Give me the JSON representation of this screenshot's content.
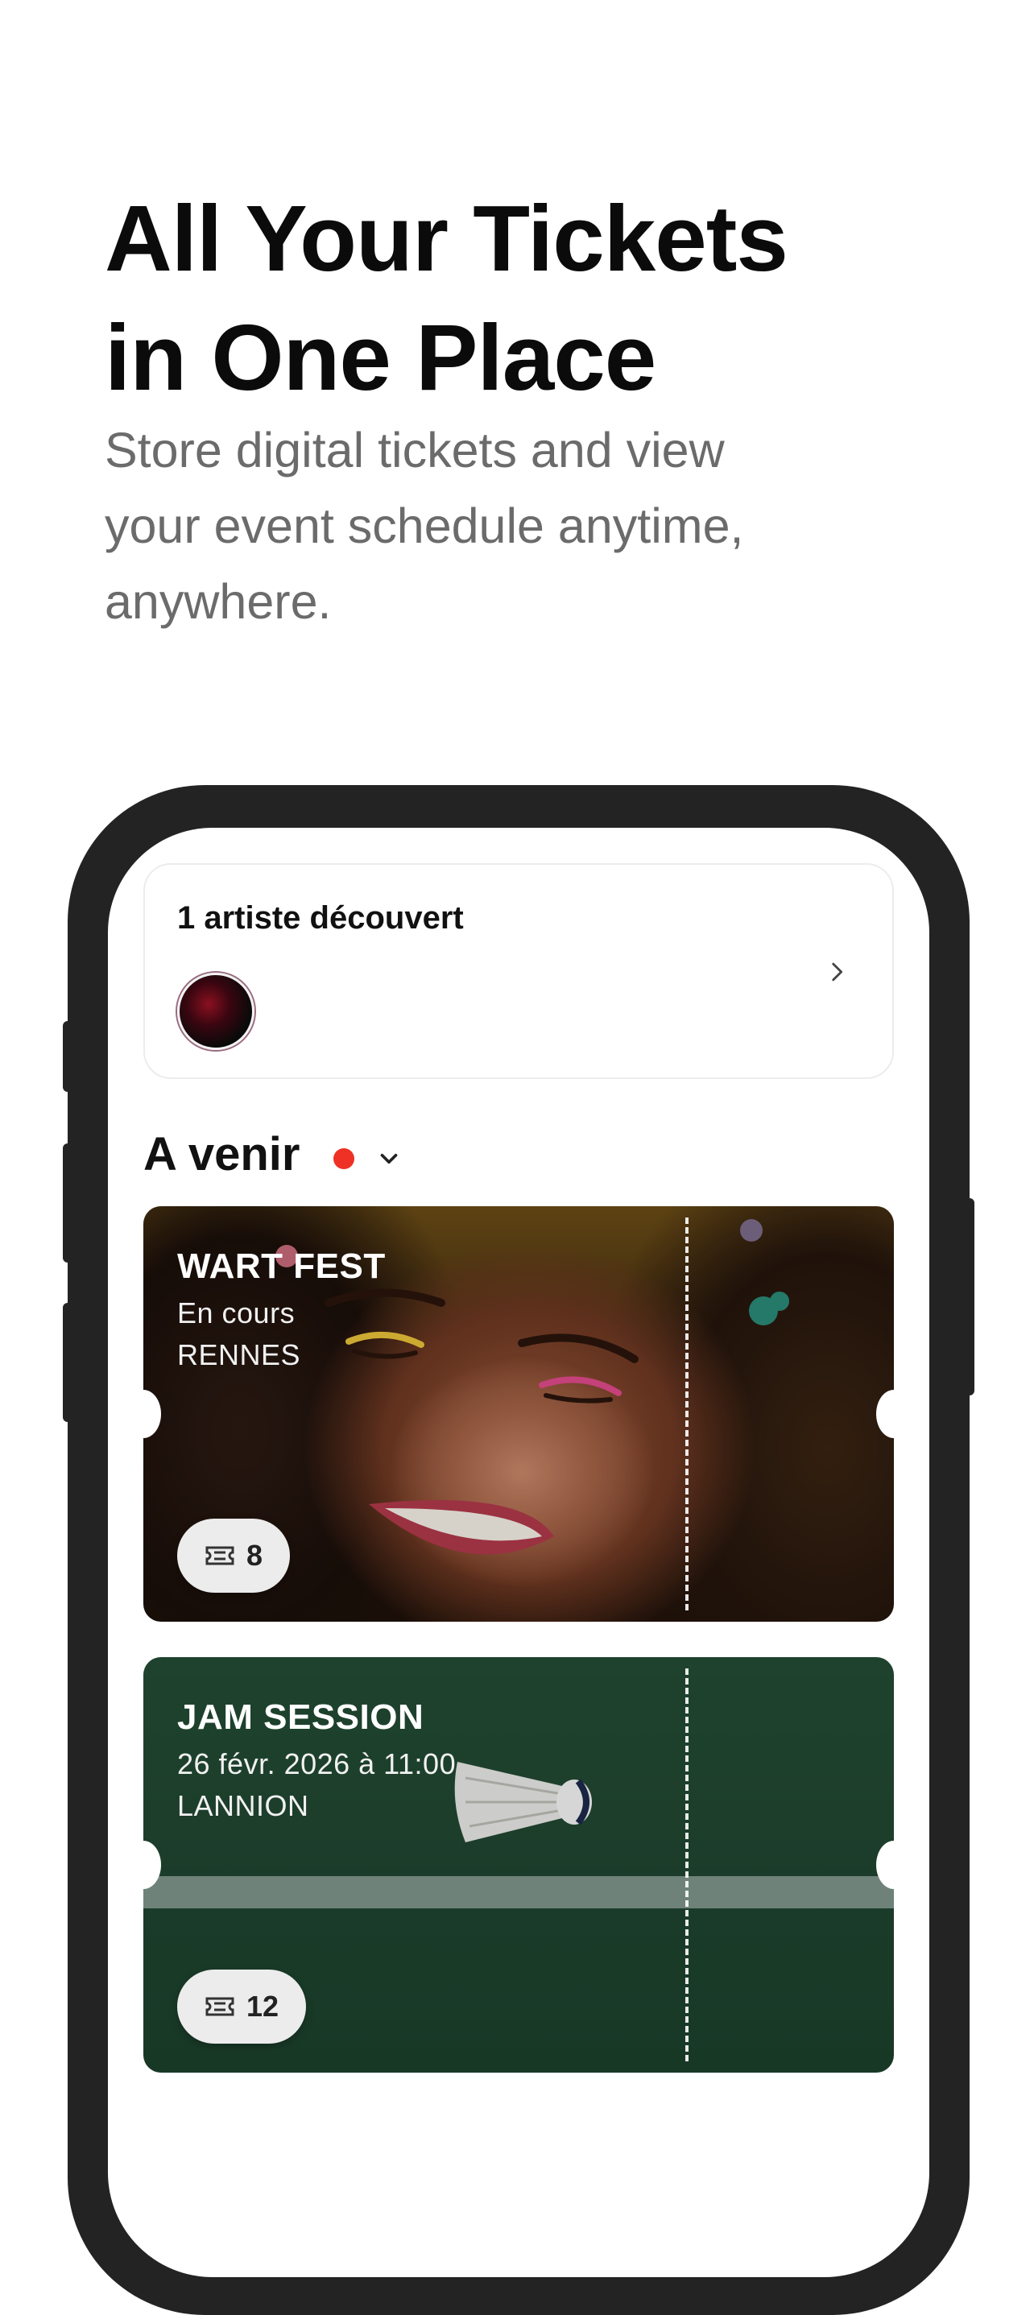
{
  "headline": "All Your Tickets\nin One Place",
  "subtitle": "Store digital tickets and view\nyour event schedule anytime,\nanywhere.",
  "app": {
    "discovery": {
      "title": "1 artiste découvert"
    },
    "section": {
      "title": "A venir"
    },
    "tickets": [
      {
        "name": "WART FEST",
        "status": "En cours",
        "city": "RENNES",
        "count": "8"
      },
      {
        "name": "JAM SESSION",
        "status": "26 févr. 2026 à 11:00",
        "city": "LANNION",
        "count": "12"
      }
    ]
  },
  "colors": {
    "live_dot": "#ee3124",
    "jam_card": "#234c35",
    "phone_frame": "#232323"
  }
}
